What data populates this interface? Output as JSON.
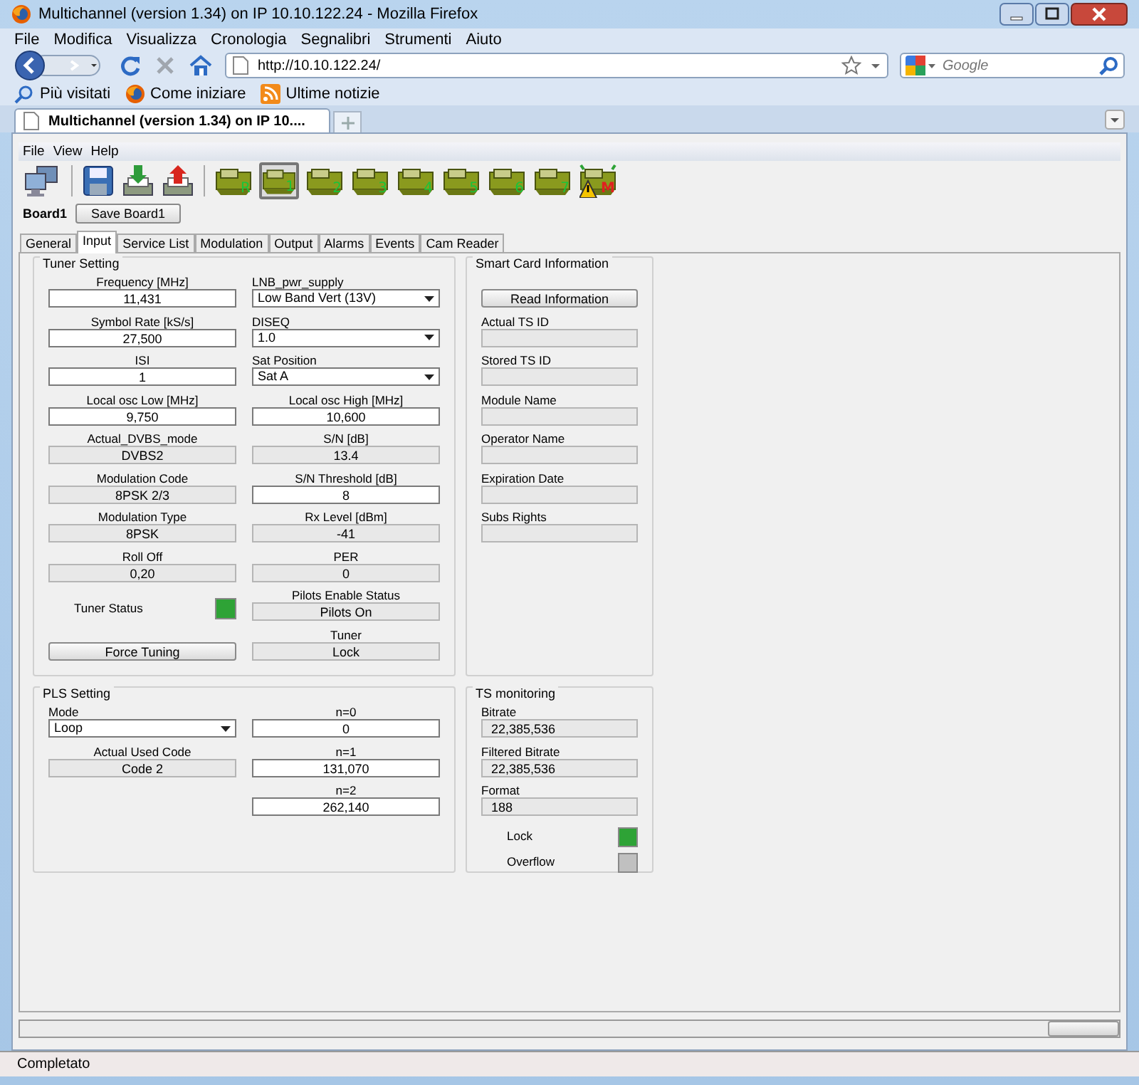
{
  "window": {
    "title": "Multichannel (version 1.34) on IP 10.10.122.24 - Mozilla Firefox"
  },
  "menu": [
    "File",
    "Modifica",
    "Visualizza",
    "Cronologia",
    "Segnalibri",
    "Strumenti",
    "Aiuto"
  ],
  "address": {
    "value": "http://10.10.122.24/"
  },
  "search": {
    "placeholder": "Google"
  },
  "bookmarks": [
    {
      "label": "Più visitati",
      "kind": "search"
    },
    {
      "label": "Come iniziare",
      "kind": "firefox"
    },
    {
      "label": "Ultime notizie",
      "kind": "feed"
    }
  ],
  "browser_tabs": [
    {
      "label": "Multichannel (version 1.34) on IP 10....",
      "selected": true
    }
  ],
  "app": {
    "menu": [
      "File",
      "View",
      "Help"
    ],
    "boards": [
      {
        "label": "R",
        "selected": false,
        "kind": "board"
      },
      {
        "label": "1",
        "selected": true,
        "kind": "board"
      },
      {
        "label": "2",
        "selected": false,
        "kind": "board"
      },
      {
        "label": "3",
        "selected": false,
        "kind": "board"
      },
      {
        "label": "4",
        "selected": false,
        "kind": "board"
      },
      {
        "label": "5",
        "selected": false,
        "kind": "board"
      },
      {
        "label": "6",
        "selected": false,
        "kind": "board"
      },
      {
        "label": "7",
        "selected": false,
        "kind": "board"
      },
      {
        "label": "M",
        "selected": false,
        "kind": "warning"
      }
    ],
    "board_name": "Board1",
    "save_button": "Save Board1",
    "tabs": [
      {
        "label": "General",
        "selected": false
      },
      {
        "label": "Input",
        "selected": true
      },
      {
        "label": "Service List",
        "selected": false
      },
      {
        "label": "Modulation",
        "selected": false
      },
      {
        "label": "Output",
        "selected": false
      },
      {
        "label": "Alarms",
        "selected": false
      },
      {
        "label": "Events",
        "selected": false
      },
      {
        "label": "Cam Reader",
        "selected": false
      }
    ],
    "groups": [
      {
        "title": "Tuner Setting",
        "kind": "centered",
        "columns": [
          [
            {
              "kind": "input",
              "label": "Frequency [MHz]",
              "value": "11,431"
            },
            {
              "kind": "input",
              "label": "Symbol Rate [kS/s]",
              "value": "27,500"
            },
            {
              "kind": "input",
              "label": "ISI",
              "value": "1"
            },
            {
              "kind": "input",
              "label": "Local osc Low [MHz]",
              "value": "9,750"
            },
            {
              "kind": "readonly",
              "label": "Actual_DVBS_mode",
              "value": "DVBS2"
            },
            {
              "kind": "readonly",
              "label": "Modulation Code",
              "value": "8PSK 2/3"
            },
            {
              "kind": "readonly",
              "label": "Modulation Type",
              "value": "8PSK"
            },
            {
              "kind": "readonly",
              "label": "Roll Off",
              "value": "0,20"
            },
            {
              "kind": "status",
              "label": "Tuner Status",
              "color": "#2ea336"
            },
            {
              "kind": "button",
              "value": "Force Tuning"
            }
          ],
          [
            {
              "kind": "select",
              "label": "LNB_pwr_supply",
              "value": "Low Band Vert (13V)"
            },
            {
              "kind": "select",
              "label": "DISEQ",
              "value": "1.0"
            },
            {
              "kind": "select",
              "label": "Sat Position",
              "value": "Sat A"
            },
            {
              "kind": "input",
              "label": "Local osc High [MHz]",
              "value": "10,600"
            },
            {
              "kind": "readonly",
              "label": "S/N [dB]",
              "value": "13.4"
            },
            {
              "kind": "input",
              "label": "S/N Threshold [dB]",
              "value": "8"
            },
            {
              "kind": "readonly",
              "label": "Rx Level [dBm]",
              "value": "-41"
            },
            {
              "kind": "readonly",
              "label": "PER",
              "value": "0"
            },
            {
              "kind": "readonly",
              "label": "Pilots Enable Status",
              "value": "Pilots On"
            },
            {
              "kind": "readonly",
              "label": "Tuner",
              "value": "Lock"
            }
          ]
        ]
      },
      {
        "title": "Smart Card Information",
        "kind": "left",
        "columns": [
          [
            {
              "kind": "button",
              "value": "Read Information"
            },
            {
              "kind": "readonly",
              "label": "Actual TS ID"
            },
            {
              "kind": "readonly",
              "label": "Stored TS ID"
            },
            {
              "kind": "readonly",
              "label": "Module Name"
            },
            {
              "kind": "readonly",
              "label": "Operator Name"
            },
            {
              "kind": "readonly",
              "label": "Expiration Date"
            },
            {
              "kind": "readonly",
              "label": "Subs Rights"
            }
          ]
        ]
      },
      {
        "title": "PLS Setting",
        "kind": "mixed",
        "columns": [
          [
            {
              "kind": "select",
              "label": "Mode",
              "value": "Loop"
            },
            {
              "kind": "readonly",
              "label": "Actual Used Code",
              "value": "Code 2"
            }
          ],
          [
            {
              "kind": "input",
              "label": "n=0",
              "value": "0"
            },
            {
              "kind": "input",
              "label": "n=1",
              "value": "131,070"
            },
            {
              "kind": "input",
              "label": "n=2",
              "value": "262,140"
            }
          ]
        ]
      },
      {
        "title": "TS monitoring",
        "kind": "left",
        "columns": [
          [
            {
              "kind": "readonly",
              "label": "Bitrate",
              "value": "22,385,536"
            },
            {
              "kind": "readonly",
              "label": "Filtered Bitrate",
              "value": "22,385,536"
            },
            {
              "kind": "readonly",
              "label": "Format",
              "value": "188"
            },
            {
              "kind": "status",
              "label": "Lock",
              "color": "#2ea336"
            },
            {
              "kind": "status",
              "label": "Overflow",
              "color": "#c0c0c0"
            }
          ]
        ]
      }
    ]
  },
  "status_bar": "Completato"
}
